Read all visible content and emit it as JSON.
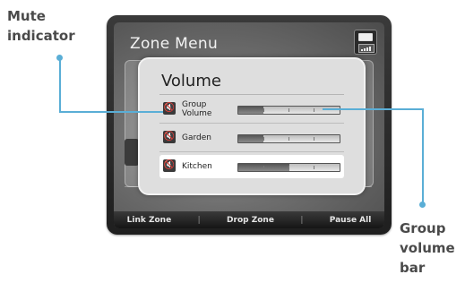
{
  "callouts": {
    "mute_indicator": "Mute indicator",
    "group_volume_bar": "Group volume bar"
  },
  "screen": {
    "title": "Zone Menu",
    "bottom_bar": [
      "Link Zone",
      "Drop Zone",
      "Pause All"
    ]
  },
  "volume_popup": {
    "title": "Volume",
    "rows": [
      {
        "label": "Group Volume",
        "level": 0.25
      },
      {
        "label": "Garden",
        "level": 0.25
      },
      {
        "label": "Kitchen",
        "level": 0.5
      }
    ]
  },
  "colors": {
    "callout_line": "#5aaed6",
    "callout_text": "#4a4a4a"
  },
  "icons": {
    "mute": "speaker-muted-icon",
    "battery": "battery-icon",
    "signal": "signal-icon"
  }
}
